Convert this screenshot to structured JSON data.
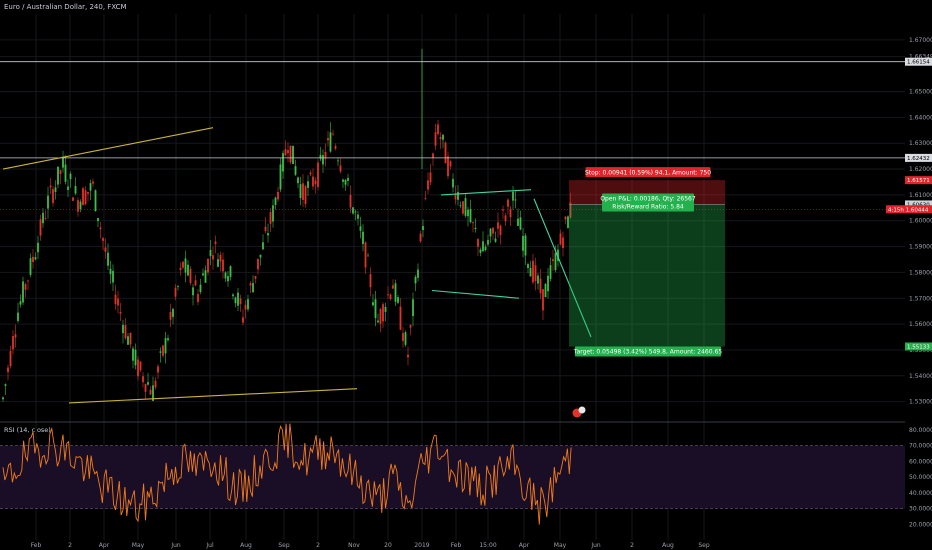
{
  "header": {
    "symbol_title": "Euro / Australian Dollar, 240, FXCM"
  },
  "rsi": {
    "title": "RSI (14, close)",
    "ticks": [
      "80.0000",
      "70.0000",
      "60.0000",
      "50.0000",
      "40.0000",
      "30.0000",
      "20.0000"
    ],
    "upper_band": 70,
    "lower_band": 30
  },
  "chart_data": {
    "type": "line",
    "title": "Euro / Australian Dollar, 240, FXCM",
    "x_axis_ticks": [
      "Feb",
      "2",
      "Apr",
      "May",
      "Jun",
      "Jul",
      "Aug",
      "Sep",
      "2",
      "Nov",
      "20",
      "2019",
      "Feb",
      "15:00",
      "Apr",
      "May",
      "Jun",
      "2",
      "Aug",
      "Sep"
    ],
    "y_axis_ticks": [
      "1.67000",
      "1.66349",
      "1.65000",
      "1.64000",
      "1.63000",
      "1.62000",
      "1.61000",
      "1.60000",
      "1.59000",
      "1.58000",
      "1.57000",
      "1.56000",
      "1.55000",
      "1.54000",
      "1.53000"
    ],
    "ylim": [
      1.5225,
      1.68
    ],
    "series": [
      {
        "values": [
          1.531,
          1.565,
          1.585,
          1.607,
          1.621,
          1.608,
          1.613,
          1.583,
          1.561,
          1.543,
          1.534,
          1.556,
          1.583,
          1.572,
          1.59,
          1.581,
          1.563,
          1.583,
          1.603,
          1.631,
          1.61,
          1.618,
          1.634,
          1.612,
          1.592,
          1.561,
          1.576,
          1.548,
          1.6,
          1.636,
          1.615,
          1.602,
          1.588,
          1.597,
          1.608,
          1.586,
          1.57,
          1.588,
          1.607
        ]
      }
    ],
    "horizontal_levels": [
      {
        "label": "1.66154",
        "value": 1.66154
      },
      {
        "label": "1.62432",
        "value": 1.62432
      }
    ],
    "price_tags": [
      {
        "label": "1.61571",
        "value": 1.61571,
        "color": "#e0242b"
      },
      {
        "label": "1.60630",
        "value": 1.6063,
        "color": "#cfd3d8"
      },
      {
        "label": "4:15h  1.60444",
        "value": 1.60444,
        "color": "#e0242b"
      },
      {
        "label": "1.55133",
        "value": 1.55133,
        "color": "#22b14c"
      }
    ],
    "trendlines": [
      {
        "points": [
          [
            0,
            1.62
          ],
          [
            7,
            1.636
          ]
        ],
        "color": "#c9b33a"
      },
      {
        "points": [
          [
            2.2,
            1.5295
          ],
          [
            11.8,
            1.535
          ]
        ],
        "color": "#c9b33a"
      },
      {
        "points": [
          [
            14.6,
            1.61
          ],
          [
            17.6,
            1.612
          ]
        ],
        "color": "#3fd6a0"
      },
      {
        "points": [
          [
            14.3,
            1.573
          ],
          [
            17.2,
            1.57
          ]
        ],
        "color": "#3fd6a0"
      },
      {
        "points": [
          [
            17.7,
            1.6085
          ],
          [
            19.6,
            1.555
          ]
        ],
        "color": "#3fd6a0"
      }
    ],
    "position": {
      "stop_label": "Stop: 0.00941 (0.59%) 94.1, Amount: 750",
      "pnl_label": "Open P&L: 0.00186, Qty: 26567",
      "ratio_label": "Risk/Reward Ratio: 5.84",
      "target_label": "Target: 0.05498 (3.42%) 549.8, Amount: 2460.65",
      "entry": 1.6063,
      "stop": 1.61571,
      "target": 1.55133,
      "stop_color": "#e0242b",
      "target_color": "#22b14c"
    },
    "rsi_values": [
      44,
      58,
      66,
      72,
      68,
      60,
      50,
      42,
      35,
      30,
      38,
      52,
      60,
      55,
      62,
      48,
      40,
      55,
      65,
      74,
      60,
      66,
      70,
      55,
      45,
      35,
      50,
      30,
      60,
      72,
      55,
      50,
      42,
      52,
      58,
      40,
      30,
      52,
      66
    ],
    "grid": true,
    "background": "#000000"
  }
}
